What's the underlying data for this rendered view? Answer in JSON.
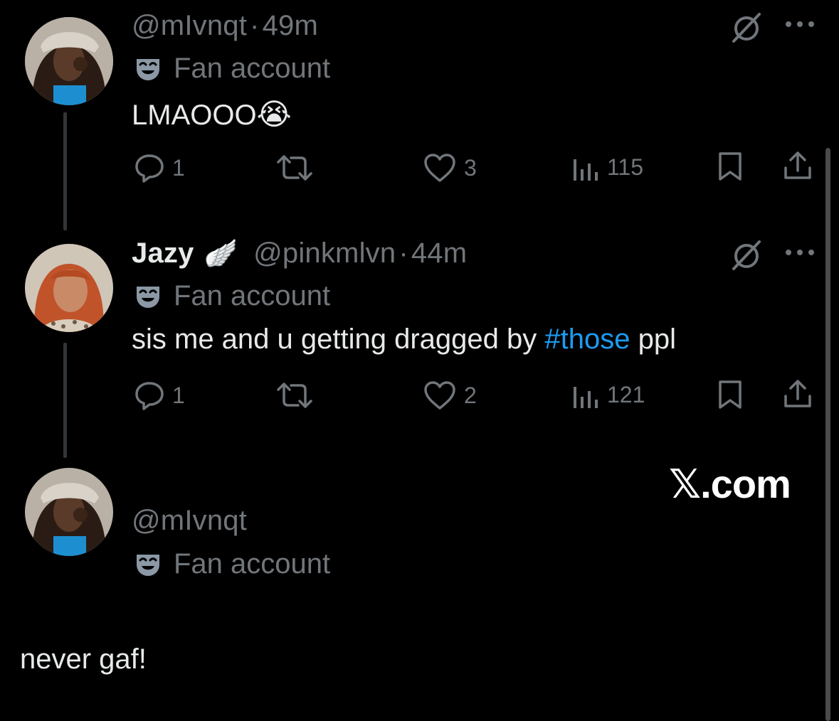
{
  "thread": {
    "tweets": [
      {
        "handle": "@mIvnqt",
        "time": "49m",
        "label": "Fan account",
        "text": "LMAOOO",
        "emoji": "😭",
        "replies": "1",
        "likes": "3",
        "views": "115"
      },
      {
        "display_name": "Jazy",
        "display_emoji": "🪽",
        "handle": "@pinkmlvn",
        "time": "44m",
        "label": "Fan account",
        "text_before": "sis me and u getting dragged by ",
        "hashtag": "#those",
        "text_after": " ppl",
        "replies": "1",
        "likes": "2",
        "views": "121"
      },
      {
        "handle": "@mIvnqt",
        "label": "Fan account"
      }
    ],
    "separator": "·"
  },
  "watermark": "𝕏.com",
  "caption": "never gaf!",
  "icons": {
    "label_icon": "theater-mask-icon",
    "grok": "grok-icon",
    "more": "more-icon",
    "reply": "reply-icon",
    "repost": "repost-icon",
    "like": "like-icon",
    "views": "views-icon",
    "bookmark": "bookmark-icon",
    "share": "share-icon"
  },
  "colors": {
    "background": "#000000",
    "text": "#e7e9ea",
    "secondary": "#71767b",
    "link": "#1d9bf0",
    "thread_line": "#333639"
  }
}
